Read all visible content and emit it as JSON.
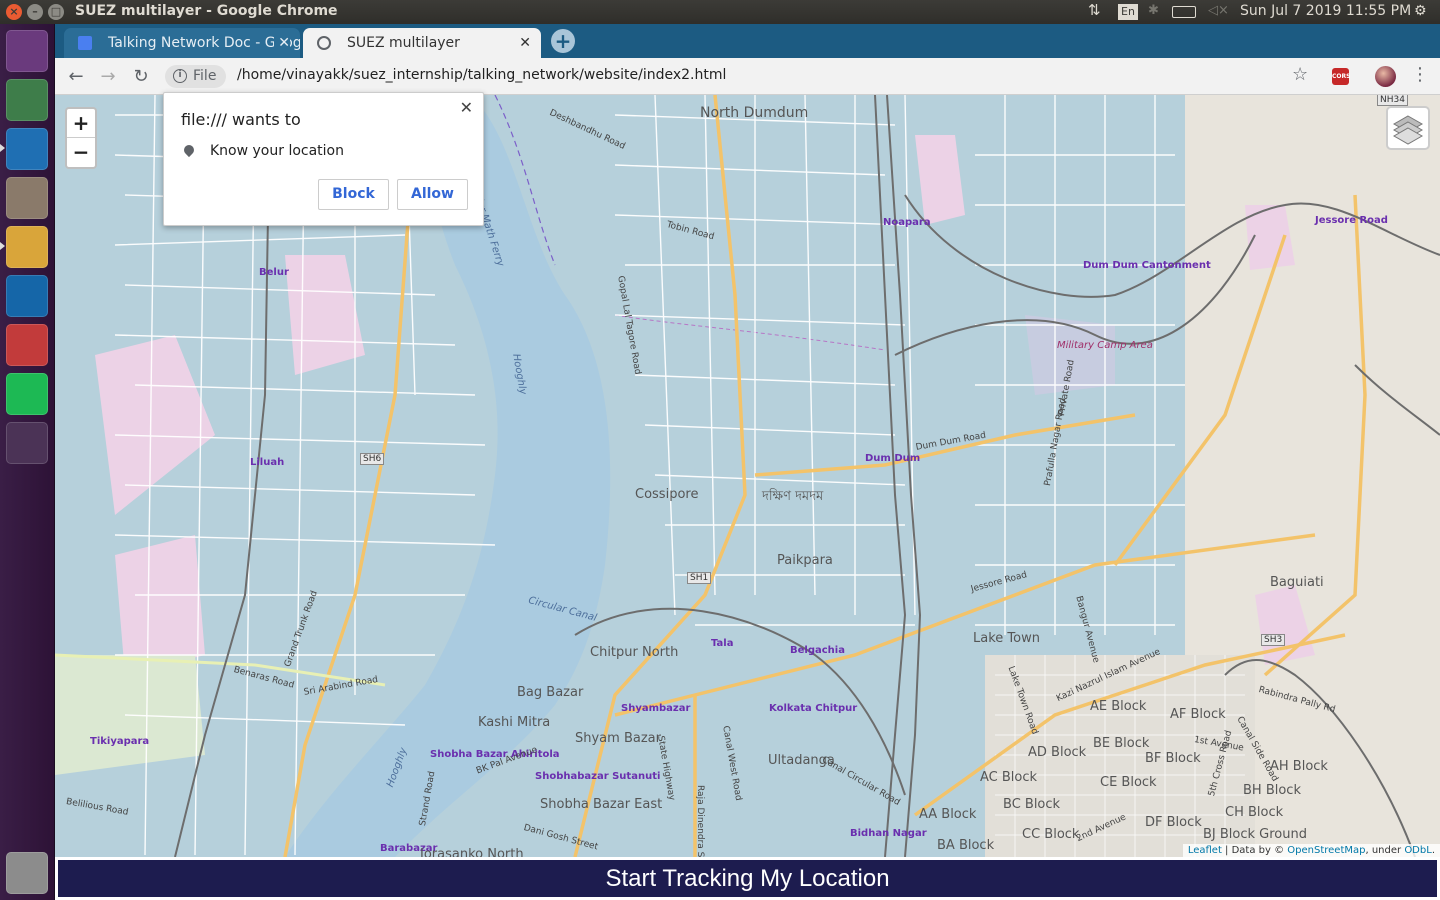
{
  "os": {
    "window_title": "SUEZ multilayer - Google Chrome",
    "lang": "En",
    "clock": "Sun Jul 7 2019 11:55 PM",
    "launcher": [
      {
        "name": "ubuntu-dash-icon",
        "color": "#6a3a7d"
      },
      {
        "name": "android-studio-icon",
        "color": "#3e7d4a"
      },
      {
        "name": "vscode-icon",
        "color": "#1f6fb3"
      },
      {
        "name": "files-icon",
        "color": "#8a7a6a"
      },
      {
        "name": "chrome-icon",
        "color": "#d9a53a"
      },
      {
        "name": "vscode-insiders-icon",
        "color": "#1566a8"
      },
      {
        "name": "spiderweb-icon",
        "color": "#c23b3b"
      },
      {
        "name": "spotify-icon",
        "color": "#1db954"
      },
      {
        "name": "workspace-switcher-icon",
        "color": "#4b3356"
      },
      {
        "name": "trash-icon",
        "color": "#8c8c8c"
      }
    ]
  },
  "browser": {
    "tabs": [
      {
        "label": "Talking Network Doc - Google Docs",
        "icon": "docs-icon"
      },
      {
        "label": "SUEZ multilayer",
        "icon": "globe-icon"
      }
    ],
    "new_tab": "+",
    "chip_label": "File",
    "url": "/home/vinayakk/suez_internship/talking_network/website/index2.html",
    "extension": "CORS"
  },
  "permission_popup": {
    "title": "file:/// wants to",
    "permission": "Know your location",
    "block_label": "Block",
    "allow_label": "Allow"
  },
  "map": {
    "zoom_in": "+",
    "zoom_out": "−",
    "attribution": {
      "leaflet": "Leaflet",
      "data_by": " | Data by © ",
      "osm": "OpenStreetMap",
      "under": ", under ",
      "odbl": "ODbL",
      "end": "."
    },
    "places": [
      {
        "text": "North Dumdum",
        "cls": "big"
      },
      {
        "text": "Deshbandhu Road",
        "cls": "road"
      },
      {
        "text": "Belur Math Ferry",
        "cls": "water"
      },
      {
        "text": "Tobin Road",
        "cls": "road"
      },
      {
        "text": "Noapara",
        "cls": "stn"
      },
      {
        "text": "Jessore Road",
        "cls": "stn"
      },
      {
        "text": "Dum Dum Cantonment",
        "cls": "stn"
      },
      {
        "text": "Belur",
        "cls": "stn"
      },
      {
        "text": "Military Camp Area",
        "cls": "mil"
      },
      {
        "text": "Gopal Lal Tagore Road",
        "cls": "road"
      },
      {
        "text": "Hooghly",
        "cls": "water"
      },
      {
        "text": "Liluah",
        "cls": "stn"
      },
      {
        "text": "Dum Dum",
        "cls": "stn"
      },
      {
        "text": "Dum Dum Road",
        "cls": "road"
      },
      {
        "text": "Cossipore",
        "cls": "med"
      },
      {
        "text": "দক্ষিণ দমদম",
        "cls": "med"
      },
      {
        "text": "Paikpara",
        "cls": "med"
      },
      {
        "text": "Lake Town",
        "cls": "med"
      },
      {
        "text": "Baguiati",
        "cls": "med"
      },
      {
        "text": "Jessore Road",
        "cls": "road"
      },
      {
        "text": "Circular Canal",
        "cls": "water"
      },
      {
        "text": "Chitpur North",
        "cls": "med"
      },
      {
        "text": "Tala",
        "cls": "stn"
      },
      {
        "text": "Belgachia",
        "cls": "stn"
      },
      {
        "text": "Bag Bazar",
        "cls": "med"
      },
      {
        "text": "Shyambazar",
        "cls": "stn"
      },
      {
        "text": "Kashi Mitra",
        "cls": "med"
      },
      {
        "text": "Shyam Bazar",
        "cls": "med"
      },
      {
        "text": "Kolkata Chitpur",
        "cls": "stn"
      },
      {
        "text": "Ultadanga",
        "cls": "med"
      },
      {
        "text": "Tikiyapara",
        "cls": "stn"
      },
      {
        "text": "Benaras Road",
        "cls": "road"
      },
      {
        "text": "Sri Arabind Road",
        "cls": "road"
      },
      {
        "text": "Grand Trunk Road",
        "cls": "road"
      },
      {
        "text": "Belilious Road",
        "cls": "road"
      },
      {
        "text": "Shobha Bazar Ahiritola",
        "cls": "stn"
      },
      {
        "text": "Shobhabazar Sutanuti",
        "cls": "stn"
      },
      {
        "text": "Shobha Bazar East",
        "cls": "med"
      },
      {
        "text": "BK Pal Avenue",
        "cls": "road"
      },
      {
        "text": "Dani Gosh Street",
        "cls": "road"
      },
      {
        "text": "Barabazar",
        "cls": "stn"
      },
      {
        "text": "Jorasanko North",
        "cls": "med"
      },
      {
        "text": "Bidhan Nagar",
        "cls": "stn"
      },
      {
        "text": "AE Block",
        "cls": "med"
      },
      {
        "text": "AF Block",
        "cls": "med"
      },
      {
        "text": "AD Block",
        "cls": "med"
      },
      {
        "text": "BE Block",
        "cls": "med"
      },
      {
        "text": "AC Block",
        "cls": "med"
      },
      {
        "text": "BF Block",
        "cls": "med"
      },
      {
        "text": "CE Block",
        "cls": "med"
      },
      {
        "text": "AH Block",
        "cls": "med"
      },
      {
        "text": "BC Block",
        "cls": "med"
      },
      {
        "text": "BH Block",
        "cls": "med"
      },
      {
        "text": "AA Block",
        "cls": "med"
      },
      {
        "text": "CH Block",
        "cls": "med"
      },
      {
        "text": "DF Block",
        "cls": "med"
      },
      {
        "text": "CC Block",
        "cls": "med"
      },
      {
        "text": "BA Block",
        "cls": "med"
      },
      {
        "text": "BJ Block Ground",
        "cls": "med"
      },
      {
        "text": "Kazi Nazrul Islam Avenue",
        "cls": "road"
      },
      {
        "text": "1st Avenue",
        "cls": "road"
      },
      {
        "text": "2nd Avenue",
        "cls": "road"
      },
      {
        "text": "Canal Circular Road",
        "cls": "road"
      },
      {
        "text": "Canal West Road",
        "cls": "road"
      },
      {
        "text": "State Highway",
        "cls": "road"
      },
      {
        "text": "Raja Dinendra St",
        "cls": "road"
      },
      {
        "text": "Strand Road",
        "cls": "road"
      },
      {
        "text": "Lake Town Road",
        "cls": "road"
      },
      {
        "text": "Bangur Avenue",
        "cls": "road"
      },
      {
        "text": "Prafulla Nagar Road",
        "cls": "road"
      },
      {
        "text": "Private Road",
        "cls": "road"
      },
      {
        "text": "Rabindra Pally Rd",
        "cls": "road"
      },
      {
        "text": "Canal Side Road",
        "cls": "road"
      },
      {
        "text": "5th Cross Road",
        "cls": "road"
      },
      {
        "text": "Hooghly",
        "cls": "water"
      }
    ],
    "shields": [
      "NH34",
      "SH6",
      "SH1",
      "SH3"
    ]
  },
  "page": {
    "track_button": "Start Tracking My Location"
  }
}
